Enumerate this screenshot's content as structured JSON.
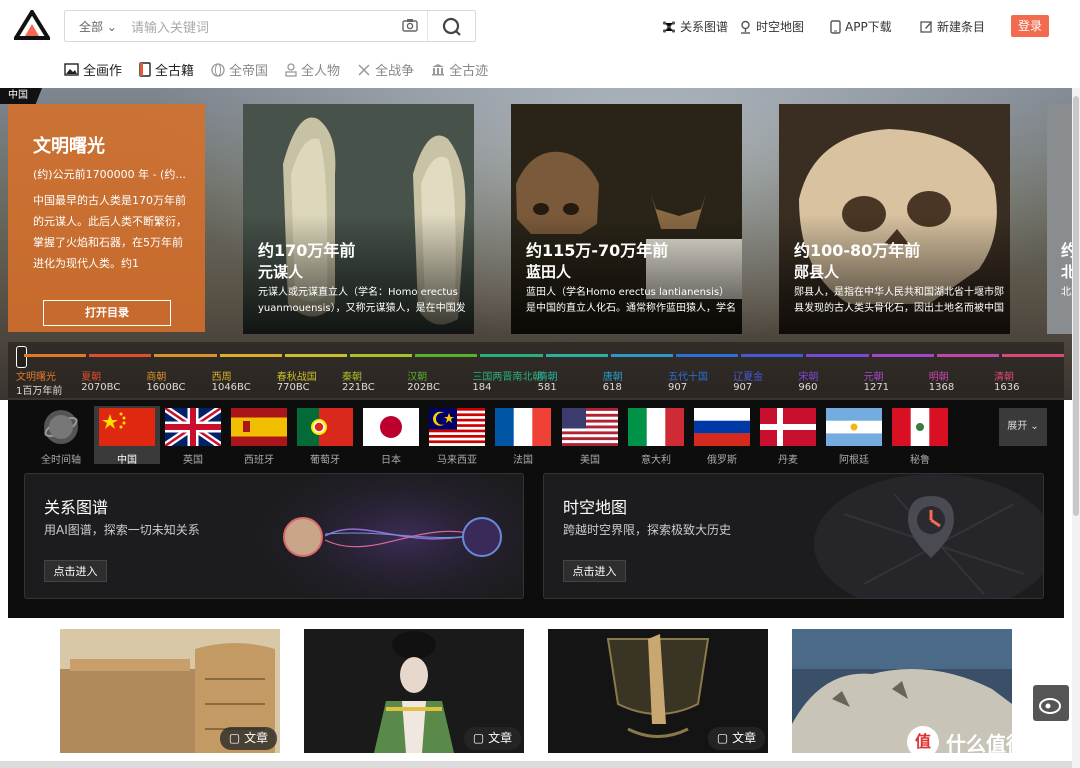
{
  "header": {
    "search": {
      "scope": "全部",
      "placeholder": "请输入关键词"
    },
    "nav": [
      {
        "label": "关系图谱",
        "icon": "graph-icon"
      },
      {
        "label": "时空地图",
        "icon": "map-pin-icon"
      },
      {
        "label": "APP下载",
        "icon": "phone-icon"
      },
      {
        "label": "新建条目",
        "icon": "edit-icon"
      }
    ],
    "login_label": "登录",
    "categories": [
      {
        "label": "全画作",
        "icon": "painting-icon"
      },
      {
        "label": "全古籍",
        "icon": "book-icon"
      },
      {
        "label": "全帝国",
        "icon": "globe-icon"
      },
      {
        "label": "全人物",
        "icon": "person-icon"
      },
      {
        "label": "全战争",
        "icon": "swords-icon"
      },
      {
        "label": "全古迹",
        "icon": "temple-icon"
      }
    ]
  },
  "banner": {
    "region_tag": "中国",
    "intro": {
      "title": "文明曙光",
      "dates": "(约)公元前1700000 年 - (约...",
      "description": "中国最早的古人类是170万年前的元谋人。此后人类不断繁衍，掌握了火焰和石器，在5万年前进化为现代人类。约1",
      "button": "打开目录"
    },
    "cards": [
      {
        "time": "约170万年前",
        "name": "元谋人",
        "desc": "元谋人或元谋直立人（学名：Homo erectus yuanmouensis），又称元谋猿人，是在中国发"
      },
      {
        "time": "约115万-70万年前",
        "name": "蓝田人",
        "desc": "蓝田人（学名Homo erectus lantianensis）是中国的直立人化石。通常称作蓝田猿人，学名直"
      },
      {
        "time": "约100-80万年前",
        "name": "郧县人",
        "desc": "郧县人，是指在中华人民共和国湖北省十堰市郧县发现的古人类头骨化石，因出土地名而被中国"
      },
      {
        "time": "约",
        "name": "北",
        "desc": "北京立"
      }
    ],
    "timeline": [
      {
        "label": "文明曙光",
        "year": "1百万年前",
        "color": "#e07a2a"
      },
      {
        "label": "夏朝",
        "year": "2070BC",
        "color": "#e04e2a"
      },
      {
        "label": "商朝",
        "year": "1600BC",
        "color": "#d8902a"
      },
      {
        "label": "西周",
        "year": "1046BC",
        "color": "#d8b02a"
      },
      {
        "label": "春秋战国",
        "year": "770BC",
        "color": "#c8c02a"
      },
      {
        "label": "秦朝",
        "year": "221BC",
        "color": "#a8c02a"
      },
      {
        "label": "汉朝",
        "year": "202BC",
        "color": "#58b02a"
      },
      {
        "label": "三国两晋南北朝",
        "year": "184",
        "color": "#2ab07a"
      },
      {
        "label": "隋朝",
        "year": "581",
        "color": "#2ab0a0"
      },
      {
        "label": "唐朝",
        "year": "618",
        "color": "#2a98c8"
      },
      {
        "label": "五代十国",
        "year": "907",
        "color": "#2a70d8"
      },
      {
        "label": "辽夏金",
        "year": "907",
        "color": "#4a58d8"
      },
      {
        "label": "宋朝",
        "year": "960",
        "color": "#7a48d8"
      },
      {
        "label": "元朝",
        "year": "1271",
        "color": "#a048c8"
      },
      {
        "label": "明朝",
        "year": "1368",
        "color": "#c048a8"
      },
      {
        "label": "清朝",
        "year": "1636",
        "color": "#d84878"
      }
    ]
  },
  "countries": {
    "items": [
      {
        "label": "全时间轴",
        "icon": "globe-icon"
      },
      {
        "label": "中国",
        "icon": "flag-china-icon"
      },
      {
        "label": "英国",
        "icon": "flag-uk-icon"
      },
      {
        "label": "西班牙",
        "icon": "flag-spain-icon"
      },
      {
        "label": "葡萄牙",
        "icon": "flag-portugal-icon"
      },
      {
        "label": "日本",
        "icon": "flag-japan-icon"
      },
      {
        "label": "马来西亚",
        "icon": "flag-malaysia-icon"
      },
      {
        "label": "法国",
        "icon": "flag-france-icon"
      },
      {
        "label": "美国",
        "icon": "flag-usa-icon"
      },
      {
        "label": "意大利",
        "icon": "flag-italy-icon"
      },
      {
        "label": "俄罗斯",
        "icon": "flag-russia-icon"
      },
      {
        "label": "丹麦",
        "icon": "flag-denmark-icon"
      },
      {
        "label": "阿根廷",
        "icon": "flag-argentina-icon"
      },
      {
        "label": "秘鲁",
        "icon": "flag-peru-icon"
      }
    ],
    "selected": "中国",
    "expand": "展开"
  },
  "features": [
    {
      "title": "关系图谱",
      "subtitle": "用AI图谱，探索一切未知关系",
      "button": "点击进入"
    },
    {
      "title": "时空地图",
      "subtitle": "跨越时空界限，探索极致大历史",
      "button": "点击进入"
    }
  ],
  "articles": [
    {
      "badge": "文章"
    },
    {
      "badge": "文章"
    },
    {
      "badge": "文章"
    },
    {
      "badge": ""
    }
  ],
  "watermark": {
    "text": "什么值得买",
    "mark": "值"
  }
}
